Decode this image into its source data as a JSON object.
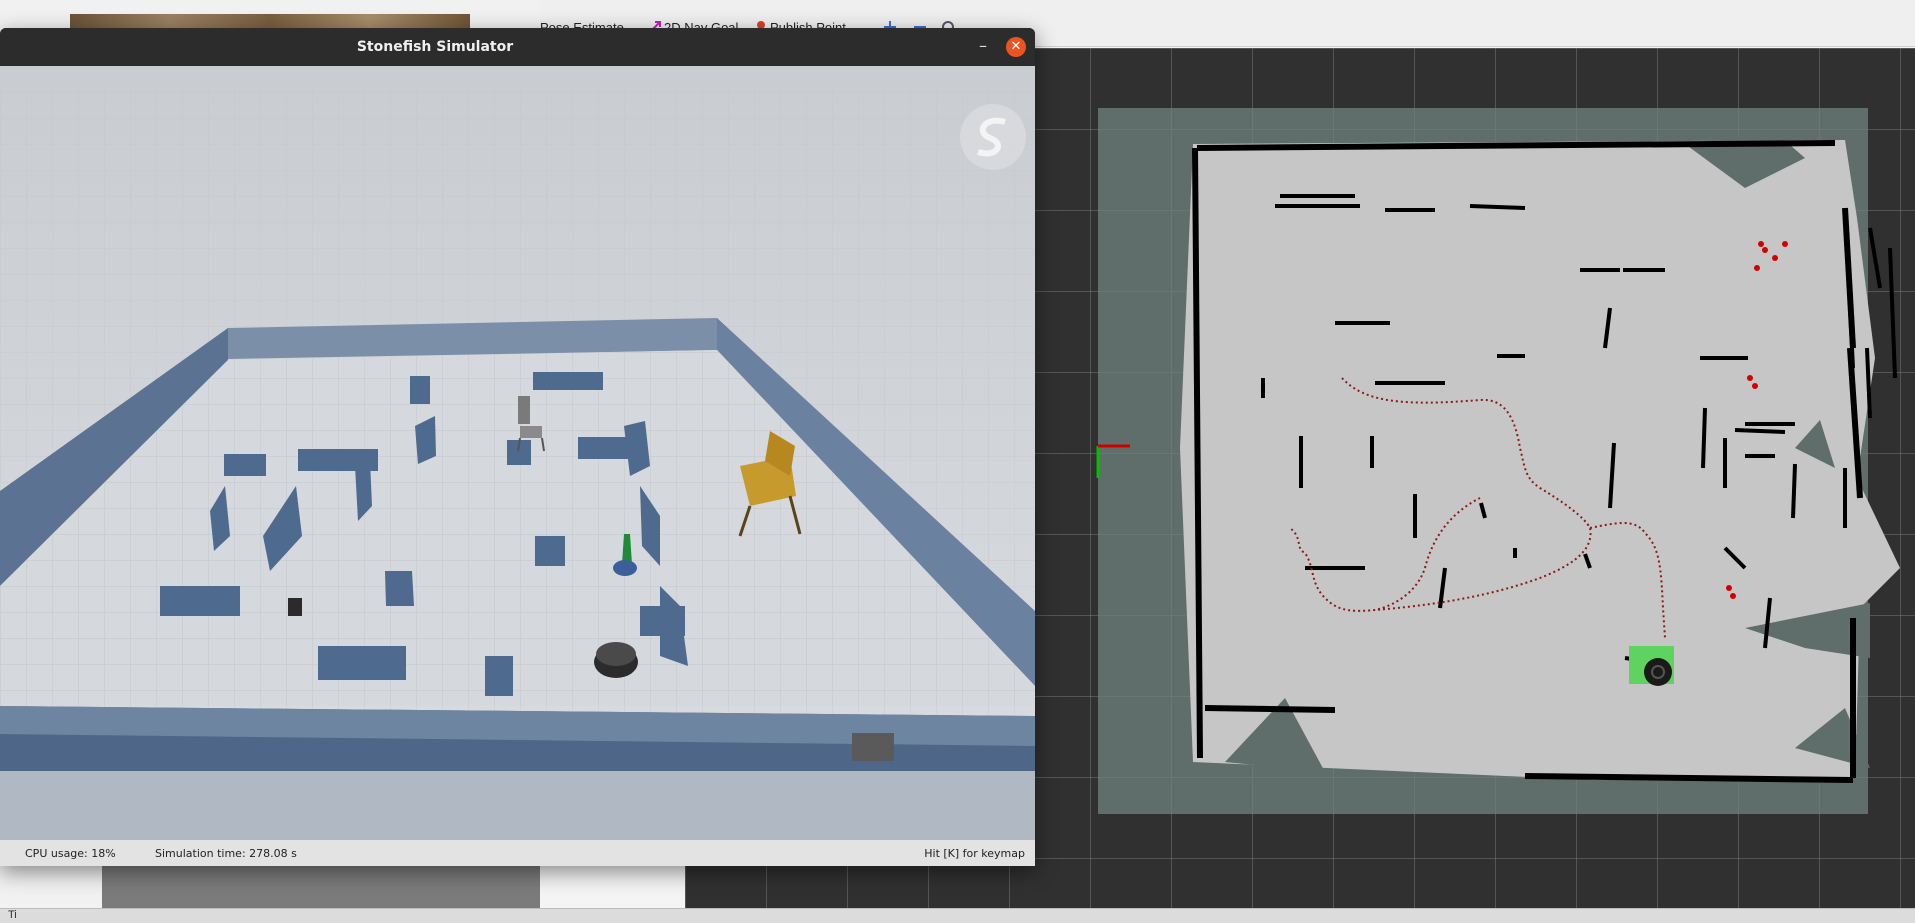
{
  "rviz": {
    "toolbar": {
      "pose_estimate": "Pose Estimate",
      "nav_goal": "2D Nav Goal",
      "publish_point": "Publish Point"
    }
  },
  "status_strip": {
    "text": "Ti"
  },
  "sim_window": {
    "title": "Stonefish Simulator",
    "minimize_glyph": "–",
    "close_glyph": "✕",
    "status": {
      "cpu": "CPU usage: 18%",
      "sim_time": "Simulation time: 278.08 s",
      "keymap_hint": "Hit [K] for keymap"
    }
  },
  "colors": {
    "occupancy_free": "#c6c6c6",
    "occupancy_unknown": "#5f6e6b",
    "path_dot": "#8b1a1a",
    "goal_marker": "#5fd35f",
    "close_button": "#e95420",
    "arena_wall": "#5b7292"
  }
}
